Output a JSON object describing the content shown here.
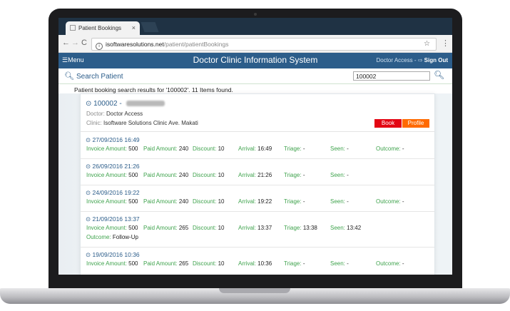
{
  "browser": {
    "tab_title": "Patient Bookings",
    "tab_close": "×",
    "url_host": "isoftwaresolutions.net",
    "url_path": "/patient/patientBookings"
  },
  "app": {
    "menu_label": "☰Menu",
    "title": "Doctor Clinic Information System",
    "access_label": "Doctor Access",
    "sign_out_label": "Sign Out"
  },
  "search": {
    "label": "Search Patient",
    "value": "100002",
    "results_text": "Patient booking search results for '100002'. 11 Items found."
  },
  "patient": {
    "id": "100002 -",
    "doctor_label": "Doctor:",
    "doctor_value": "Doctor Access",
    "clinic_label": "Clinic:",
    "clinic_value": "Isoftware Solutions Clinic Ave. Makati",
    "book_label": "Book",
    "profile_label": "Profile"
  },
  "labels": {
    "invoice": "Invoice Amount:",
    "paid": "Paid Amount:",
    "discount": "Discount:",
    "arrival": "Arrival:",
    "triage": "Triage:",
    "seen": "Seen:",
    "outcome": "Outcome:"
  },
  "bookings": [
    {
      "date": "27/09/2016 16:49",
      "invoice": "500",
      "paid": "240",
      "discount": "10",
      "arrival": "16:49",
      "triage": "-",
      "seen": "-",
      "outcome": "-"
    },
    {
      "date": "26/09/2016 21:26",
      "invoice": "500",
      "paid": "240",
      "discount": "10",
      "arrival": "21:26",
      "triage": "-",
      "seen": "-",
      "outcome": "-"
    },
    {
      "date": "24/09/2016 19:22",
      "invoice": "500",
      "paid": "240",
      "discount": "10",
      "arrival": "19:22",
      "triage": "-",
      "seen": "-",
      "outcome": "-"
    },
    {
      "date": "21/09/2016 13:37",
      "invoice": "500",
      "paid": "265",
      "discount": "10",
      "arrival": "13:37",
      "triage": "13:38",
      "seen": "13:42",
      "outcome": "Follow-Up"
    },
    {
      "date": "19/09/2016 10:36",
      "invoice": "500",
      "paid": "265",
      "discount": "10",
      "arrival": "10:36",
      "triage": "-",
      "seen": "-",
      "outcome": "-"
    }
  ],
  "colors": {
    "header_blue": "#2c5d8a",
    "label_green": "#3fa34d",
    "book_red": "#e30613",
    "profile_orange": "#ff6a00"
  }
}
